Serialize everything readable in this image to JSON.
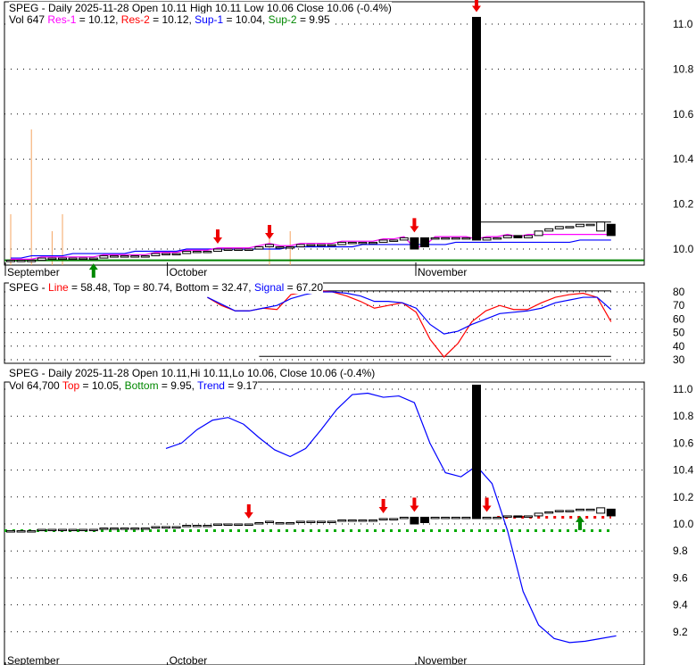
{
  "panel1": {
    "line1": {
      "ticker": "SPEG - Daily 2025-11-28 Open 10.11  High 10.11  Low 10.06  Close 10.06 (-0.4%)"
    },
    "line2": {
      "vol": "Vol 647",
      "res1_label": "Res-1",
      "res1_val": " = 10.12, ",
      "res2_label": "Res-2",
      "res2_val": " = 10.12, ",
      "sup1_label": "Sup-1",
      "sup1_val": " = 10.04, ",
      "sup2_label": "Sup-2",
      "sup2_val": " = 9.95"
    }
  },
  "panel2": {
    "prefix": "SPEG - ",
    "line_label": "Line",
    "line_val": " = 58.48, Top = 80.74, Bottom = 32.47, ",
    "signal_label": "Signal",
    "signal_val": " = 67.20"
  },
  "panel3": {
    "line1": "SPEG - Daily 2025-11-28 Open 10.11,Hi 10.11,Lo 10.06, Close 10.06 (-0.4%)",
    "line2": {
      "vol": "Vol 64,700 ",
      "top_label": "Top",
      "top_val": " = 10.05, ",
      "bottom_label": "Bottom",
      "bottom_val": " = 9.95, ",
      "trend_label": "Trend",
      "trend_val": " = 9.17"
    }
  },
  "colors": {
    "res1": "#ff00ff",
    "res2": "#ff0000",
    "sup1": "#0000ff",
    "sup2": "#008000",
    "volume": "#f4a460"
  },
  "chart_data": [
    {
      "type": "candlestick",
      "title": "SPEG - Daily 2025-11-28",
      "x_labels": [
        {
          "label": "September",
          "index": 0
        },
        {
          "label": "October",
          "index": 16
        },
        {
          "label": "November",
          "index": 40
        }
      ],
      "yticks": [
        "11.0",
        "10.8",
        "10.6",
        "10.4",
        "10.2",
        "10.0"
      ],
      "ytick_values": [
        11.0,
        10.8,
        10.6,
        10.4,
        10.2,
        10.0
      ],
      "ylim": [
        9.93,
        11.1
      ],
      "open": [
        9.95,
        9.95,
        9.95,
        9.95,
        9.96,
        9.96,
        9.96,
        9.96,
        9.96,
        9.96,
        9.97,
        9.97,
        9.97,
        9.97,
        9.97,
        9.98,
        9.98,
        9.98,
        9.99,
        9.99,
        9.99,
        10.0,
        10.0,
        10.0,
        10.0,
        10.01,
        10.01,
        10.01,
        10.01,
        10.02,
        10.02,
        10.02,
        10.02,
        10.03,
        10.03,
        10.03,
        10.03,
        10.04,
        10.04,
        10.05,
        10.05,
        10.05,
        10.05,
        10.05,
        10.05,
        11.03,
        10.04,
        10.05,
        10.05,
        10.06,
        10.05,
        10.06,
        10.08,
        10.09,
        10.1,
        10.1,
        10.11,
        10.08,
        10.11
      ],
      "close": [
        9.95,
        9.95,
        9.95,
        9.96,
        9.96,
        9.96,
        9.96,
        9.96,
        9.96,
        9.97,
        9.97,
        9.97,
        9.97,
        9.97,
        9.98,
        9.98,
        9.98,
        9.99,
        9.99,
        9.99,
        10.0,
        10.0,
        10.0,
        10.0,
        10.01,
        10.02,
        10.01,
        10.01,
        10.02,
        10.02,
        10.02,
        10.02,
        10.03,
        10.03,
        10.03,
        10.03,
        10.04,
        10.04,
        10.05,
        10.0,
        10.01,
        10.05,
        10.05,
        10.05,
        10.05,
        10.04,
        10.05,
        10.05,
        10.06,
        10.05,
        10.06,
        10.08,
        10.09,
        10.1,
        10.1,
        10.11,
        10.11,
        10.12,
        10.06
      ],
      "volume": [
        0.3,
        0.1,
        0.8,
        0.1,
        0.2,
        0.3,
        0.1,
        0.1,
        0.1,
        0.1,
        0.1,
        0.1,
        0.1,
        0.1,
        0.1,
        0.1,
        0.1,
        0.1,
        0.1,
        0.1,
        0.1,
        0.1,
        0.1,
        0.1,
        0.1,
        0.2,
        0.1,
        0.2,
        0.1,
        0.1,
        0.1,
        0.1,
        0.1,
        0.1,
        0.1,
        0.1,
        0.1,
        0.1,
        0.1,
        0.1,
        0.1,
        0.1,
        0.1,
        0.1,
        0.1,
        0.1,
        0.1,
        0.1,
        0.1,
        0.1,
        0.1,
        0.1,
        0.1,
        0.1,
        0.1,
        0.1,
        0.1,
        0.1,
        0.1
      ],
      "sup1_line": [
        9.96,
        9.96,
        9.97,
        9.97,
        9.97,
        9.97,
        9.98,
        9.98,
        9.98,
        9.98,
        9.98,
        9.98,
        9.99,
        9.99,
        9.99,
        9.99,
        9.99,
        10.0,
        10.0,
        10.0,
        10.0,
        10.0,
        10.0,
        10.0,
        10.0,
        10.0,
        10.0,
        10.01,
        10.01,
        10.01,
        10.01,
        10.01,
        10.01,
        10.01,
        10.02,
        10.02,
        10.02,
        10.02,
        10.02,
        10.02,
        10.02,
        10.02,
        10.02,
        10.03,
        10.03,
        10.03,
        10.03,
        10.03,
        10.03,
        10.03,
        10.03,
        10.03,
        10.03,
        10.03,
        10.03,
        10.04,
        10.04,
        10.04,
        10.04
      ],
      "res_lines": [
        {
          "value": 10.12,
          "from": 45,
          "to": 58
        }
      ],
      "sell_arrows": [
        20,
        25,
        39,
        45
      ],
      "buy_arrows": [
        8
      ]
    },
    {
      "type": "line",
      "yticks": [
        "80",
        "70",
        "60",
        "50",
        "40",
        "30"
      ],
      "ytick_values": [
        80,
        70,
        60,
        50,
        40,
        30
      ],
      "ylim": [
        28,
        84
      ],
      "start_index": 19,
      "series": [
        {
          "name": "Line",
          "color": "#ff0000",
          "values": [
            76,
            70,
            66,
            66,
            68,
            67,
            78,
            80,
            81,
            80,
            77,
            73,
            68,
            70,
            72,
            65,
            45,
            32,
            42,
            58,
            66,
            70,
            67,
            67,
            72,
            76,
            78,
            79,
            76,
            58
          ]
        },
        {
          "name": "Signal",
          "color": "#0000ff",
          "values": [
            76,
            71,
            66,
            66,
            68,
            70,
            75,
            78,
            80,
            80,
            79,
            77,
            73,
            73,
            72,
            68,
            56,
            49,
            51,
            56,
            60,
            64,
            65,
            66,
            68,
            72,
            74,
            76,
            76,
            67
          ]
        }
      ],
      "top": 80.74,
      "bottom": 32.47
    },
    {
      "type": "candlestick",
      "yticks": [
        "11.0",
        "10.8",
        "10.6",
        "10.4",
        "10.2",
        "10.0",
        "9.8",
        "9.6",
        "9.4",
        "9.2"
      ],
      "ytick_values": [
        11.0,
        10.8,
        10.6,
        10.4,
        10.2,
        10.0,
        9.8,
        9.6,
        9.4,
        9.2
      ],
      "ylim": [
        9.0,
        11.06
      ],
      "trend": {
        "start_index": 15,
        "values": [
          10.56,
          10.6,
          10.7,
          10.77,
          10.79,
          10.74,
          10.64,
          10.55,
          10.5,
          10.56,
          10.7,
          10.85,
          10.96,
          10.97,
          10.94,
          10.95,
          10.9,
          10.6,
          10.38,
          10.35,
          10.43,
          10.3,
          9.95,
          9.5,
          9.25,
          9.15,
          9.12,
          9.13,
          9.15,
          9.17
        ]
      },
      "top": 10.05,
      "bottom": 9.95,
      "sell_arrows": [
        23,
        36,
        39,
        46
      ],
      "buy_arrows": [
        55
      ]
    }
  ]
}
